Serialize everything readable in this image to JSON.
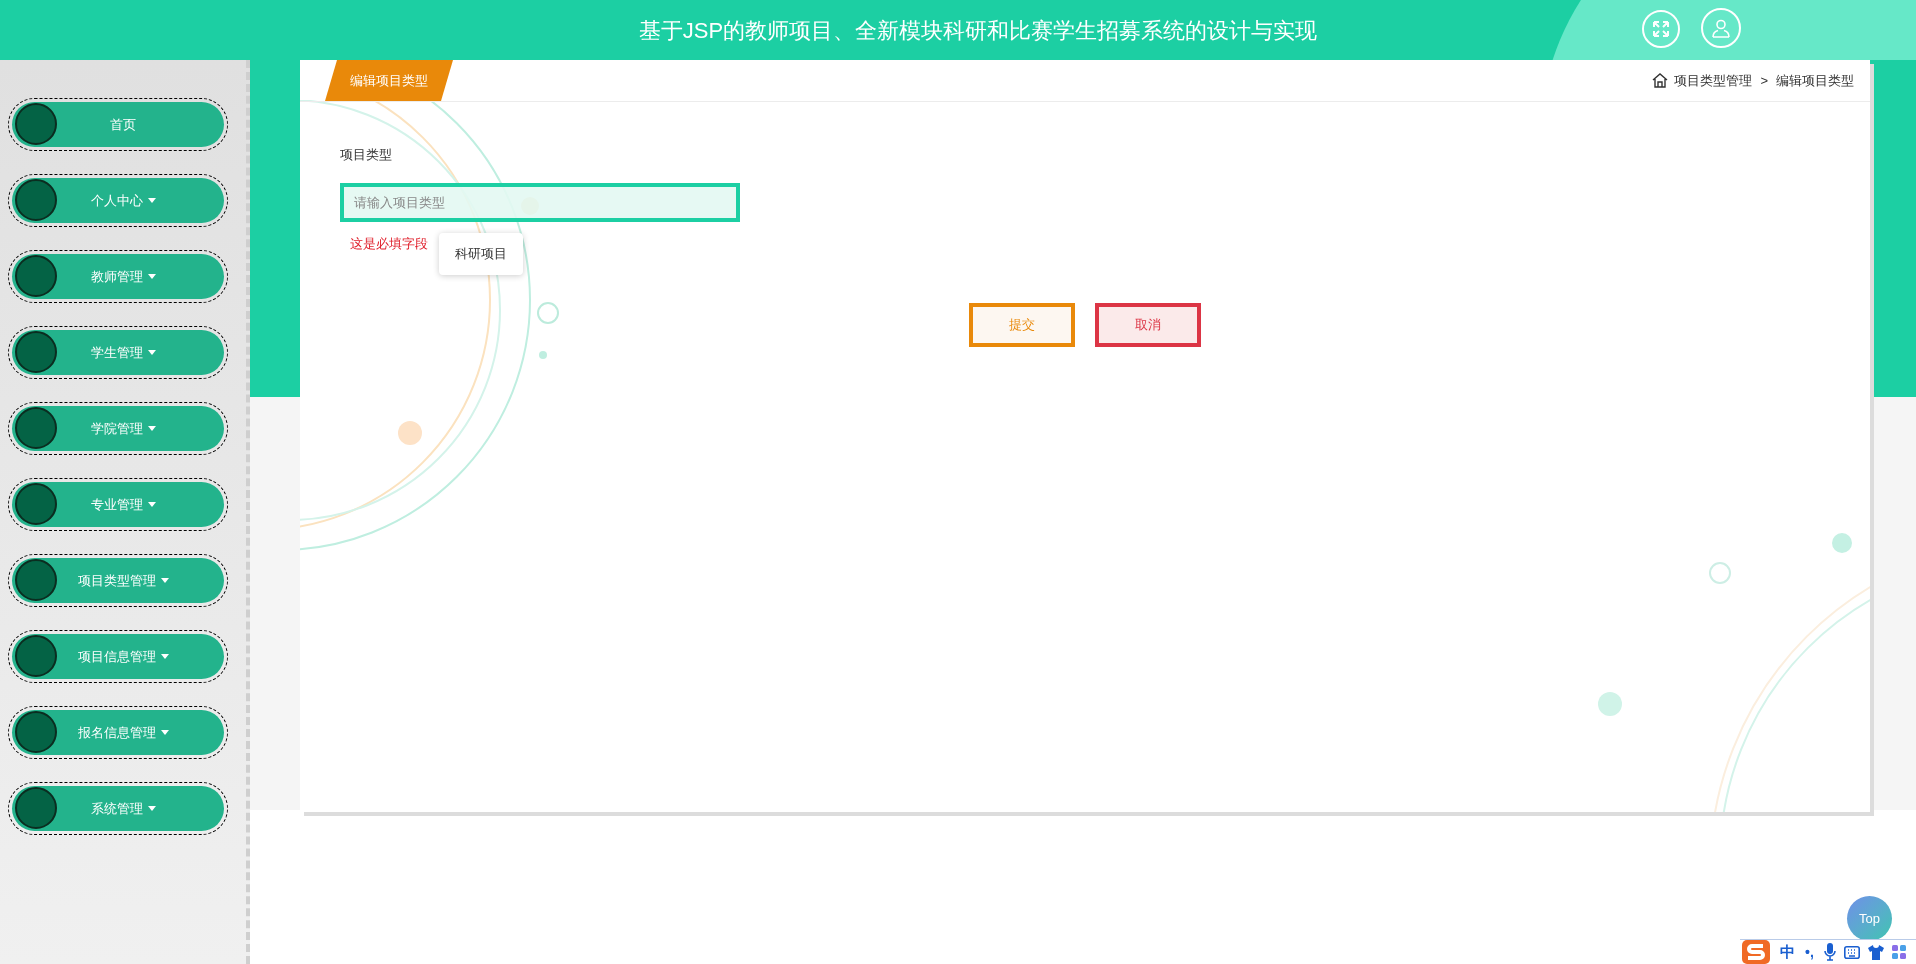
{
  "header": {
    "title": "基于JSP的教师项目、全新模块科研和比赛学生招募系统的设计与实现"
  },
  "sidebar": {
    "items": [
      {
        "label": "首页",
        "dropdown": false
      },
      {
        "label": "个人中心",
        "dropdown": true
      },
      {
        "label": "教师管理",
        "dropdown": true
      },
      {
        "label": "学生管理",
        "dropdown": true
      },
      {
        "label": "学院管理",
        "dropdown": true
      },
      {
        "label": "专业管理",
        "dropdown": true
      },
      {
        "label": "项目类型管理",
        "dropdown": true
      },
      {
        "label": "项目信息管理",
        "dropdown": true
      },
      {
        "label": "报名信息管理",
        "dropdown": true
      },
      {
        "label": "系统管理",
        "dropdown": true
      }
    ]
  },
  "card": {
    "tab_title": "编辑项目类型",
    "breadcrumb": {
      "items": [
        "项目类型管理",
        "编辑项目类型"
      ],
      "separator": ">"
    },
    "form": {
      "label": "项目类型",
      "placeholder": "请输入项目类型",
      "error": "这是必填字段",
      "suggestion": "科研项目",
      "buttons": [
        {
          "label": "提交",
          "kind": "submit"
        },
        {
          "label": "取消",
          "kind": "cancel"
        }
      ]
    }
  },
  "back_to_top": "Top",
  "ime_toolbar": {
    "mode": "中",
    "punctuation": "•,"
  }
}
